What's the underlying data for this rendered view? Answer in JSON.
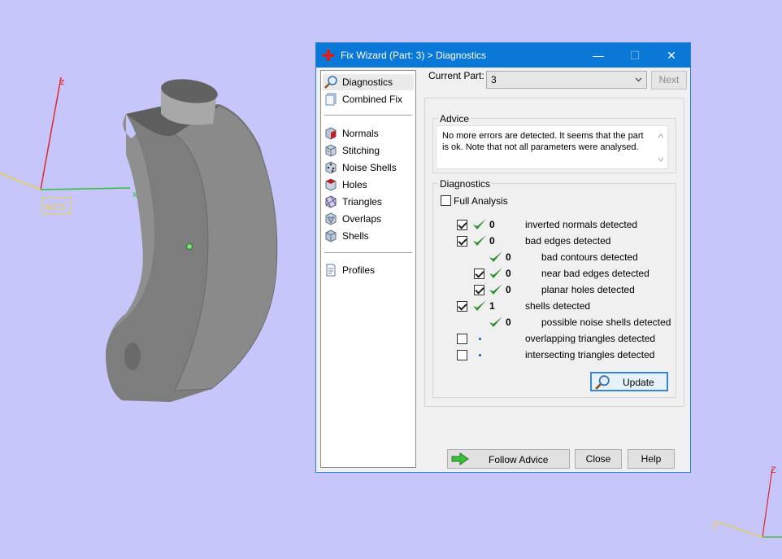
{
  "viewport": {
    "axes_left": {
      "z_label": "z",
      "x_label": "x",
      "wcs_label": "WCS"
    },
    "axes_right": {
      "z_label": "Z",
      "y_label": "Y"
    },
    "colors": {
      "background": "#c6c6fa",
      "part": "#8a8a8a"
    }
  },
  "dialog": {
    "title": "Fix Wizard (Part: 3) > Diagnostics",
    "title_icon": "red-cross-icon",
    "window_buttons": {
      "minimize": "—",
      "maximize": "☐",
      "close": "✕"
    },
    "nav": {
      "items": [
        {
          "label": "Diagnostics",
          "icon": "magnifier-icon",
          "selected": true
        },
        {
          "label": "Combined Fix",
          "icon": "stack-icon"
        },
        {
          "label": "Normals",
          "icon": "normals-cube-icon"
        },
        {
          "label": "Stitching",
          "icon": "stitching-cube-icon"
        },
        {
          "label": "Noise Shells",
          "icon": "noise-shells-cube-icon"
        },
        {
          "label": "Holes",
          "icon": "holes-cube-icon"
        },
        {
          "label": "Triangles",
          "icon": "triangles-cube-icon"
        },
        {
          "label": "Overlaps",
          "icon": "overlaps-cube-icon"
        },
        {
          "label": "Shells",
          "icon": "shells-cube-icon"
        },
        {
          "label": "Profiles",
          "icon": "profile-document-icon"
        }
      ]
    },
    "current_part": {
      "label": "Current Part:",
      "value": "3",
      "next_label": "Next"
    },
    "advice": {
      "title": "Advice",
      "text_line1": "No more errors are detected. It seems that the part",
      "text_line2": "is ok. Note that not all parameters were analysed."
    },
    "diagnostics": {
      "title": "Diagnostics",
      "full_analysis_label": "Full Analysis",
      "full_analysis_checked": false,
      "rows": [
        {
          "checked": true,
          "status": "ok",
          "count": "0",
          "label": "inverted normals detected"
        },
        {
          "checked": true,
          "status": "ok",
          "count": "0",
          "label": "bad edges detected"
        },
        {
          "checked": null,
          "status": "ok",
          "count": "0",
          "label": "bad contours detected"
        },
        {
          "checked": true,
          "status": "ok",
          "count": "0",
          "label": "near bad edges detected"
        },
        {
          "checked": true,
          "status": "ok",
          "count": "0",
          "label": "planar holes detected"
        },
        {
          "checked": true,
          "status": "ok",
          "count": "1",
          "label": "shells detected"
        },
        {
          "checked": null,
          "status": "ok",
          "count": "0",
          "label": "possible noise shells detected"
        },
        {
          "checked": false,
          "status": "unknown",
          "count": "",
          "label": "overlapping triangles detected"
        },
        {
          "checked": false,
          "status": "unknown",
          "count": "",
          "label": "intersecting triangles detected"
        }
      ],
      "update_label": "Update"
    },
    "footer": {
      "follow_advice_label": "Follow Advice",
      "close_label": "Close",
      "help_label": "Help"
    }
  }
}
